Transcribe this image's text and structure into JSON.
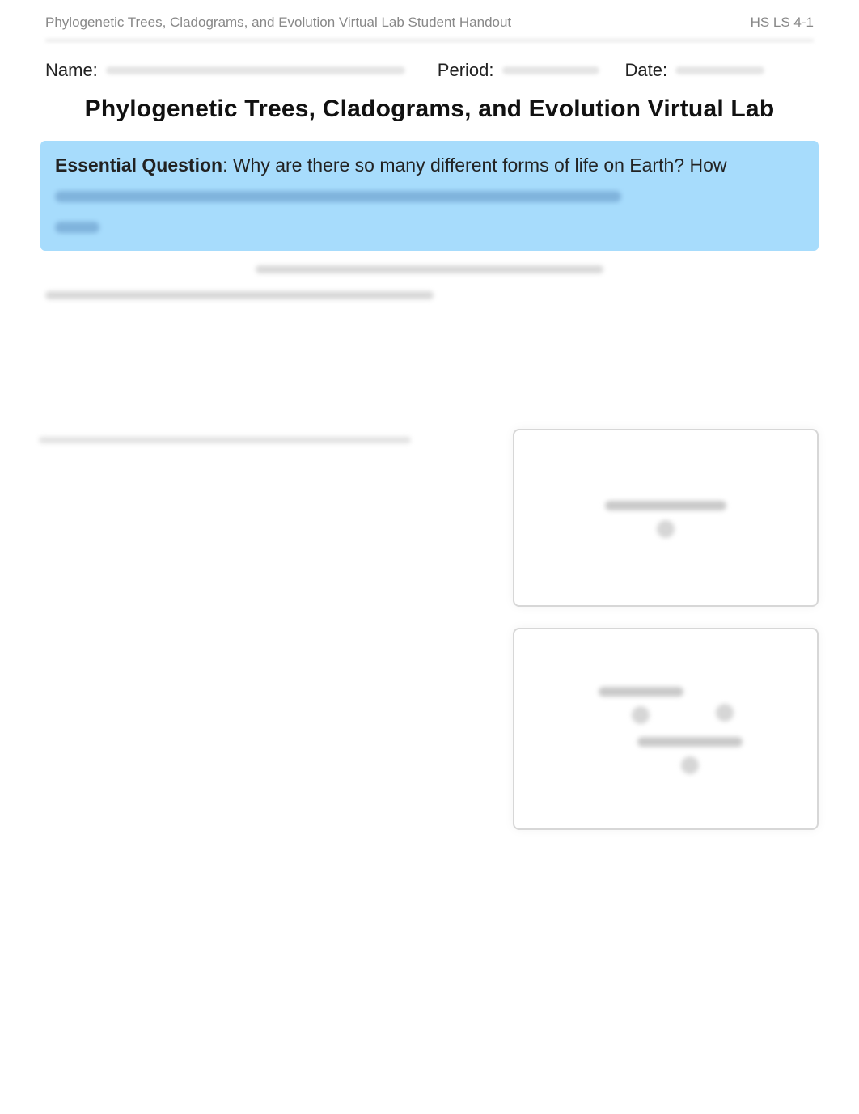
{
  "header": {
    "left": "Phylogenetic Trees, Cladograms, and Evolution Virtual Lab Student Handout",
    "right": "HS LS 4-1"
  },
  "form": {
    "name_label": "Name:",
    "period_label": "Period:",
    "date_label": "Date:"
  },
  "title": "Phylogenetic Trees, Cladograms, and Evolution Virtual Lab",
  "essential_question": {
    "label": "Essential Question",
    "visible_text": ": Why are there so many different forms of life on Earth? How"
  }
}
